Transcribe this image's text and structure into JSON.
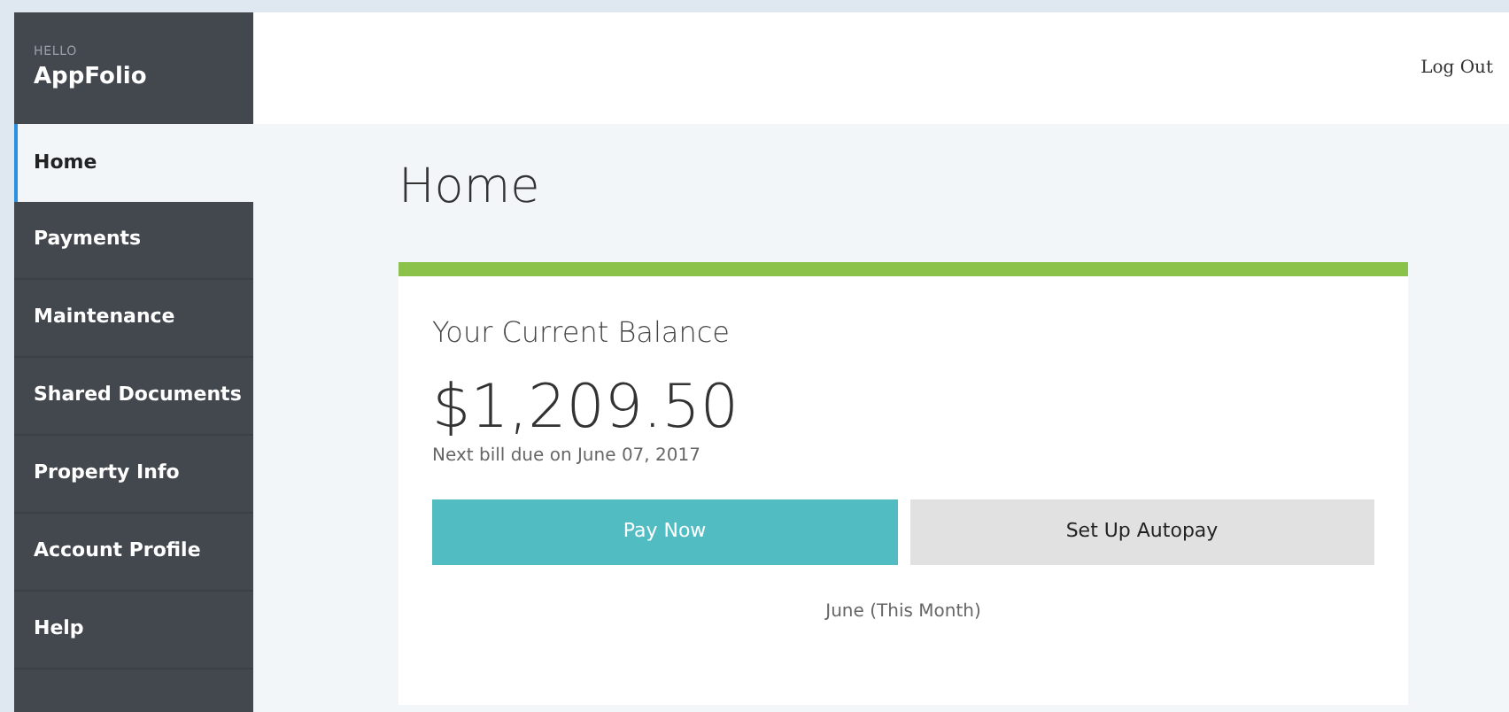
{
  "sidebar": {
    "greeting": "HELLO",
    "brand": "AppFolio",
    "items": [
      {
        "label": "Home",
        "selected": true
      },
      {
        "label": "Payments",
        "selected": false
      },
      {
        "label": "Maintenance",
        "selected": false
      },
      {
        "label": "Shared Documents",
        "selected": false
      },
      {
        "label": "Property Info",
        "selected": false
      },
      {
        "label": "Account Profile",
        "selected": false
      },
      {
        "label": "Help",
        "selected": false
      }
    ]
  },
  "header": {
    "logout": "Log Out"
  },
  "page_title": "Home",
  "balance_card": {
    "title": "Your Current Balance",
    "amount": "$1,209.50",
    "due_note": "Next bill due on June 07, 2017",
    "buttons": [
      {
        "label": "Pay Now",
        "kind": "primary"
      },
      {
        "label": "Set Up Autopay",
        "kind": "secondary"
      }
    ],
    "month_label": "June (This Month)"
  }
}
